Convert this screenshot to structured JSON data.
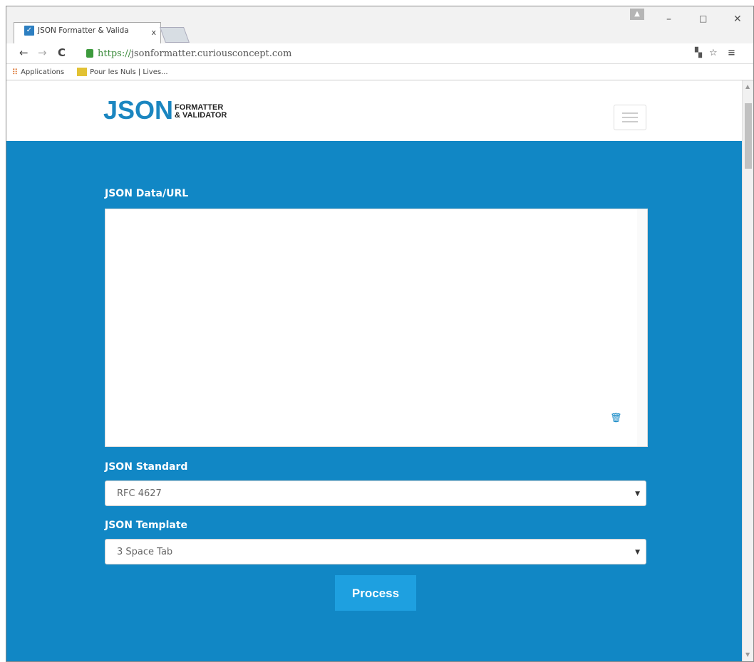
{
  "browser": {
    "tab_title": "JSON Formatter & Valida",
    "tab_close": "x",
    "url_scheme": "https://",
    "url_host": "jsonformatter.curiousconcept.com",
    "bookmarks": [
      {
        "label": "Applications"
      },
      {
        "label": "Pour les Nuls | Lives..."
      }
    ]
  },
  "site": {
    "logo_big": "JSON",
    "logo_small_1": "FORMATTER",
    "logo_small_2": "& VALIDATOR"
  },
  "form": {
    "data_label": "JSON Data/URL",
    "data_value": "",
    "standard_label": "JSON Standard",
    "standard_value": "RFC 4627",
    "template_label": "JSON Template",
    "template_value": "3 Space Tab",
    "process_label": "Process"
  }
}
